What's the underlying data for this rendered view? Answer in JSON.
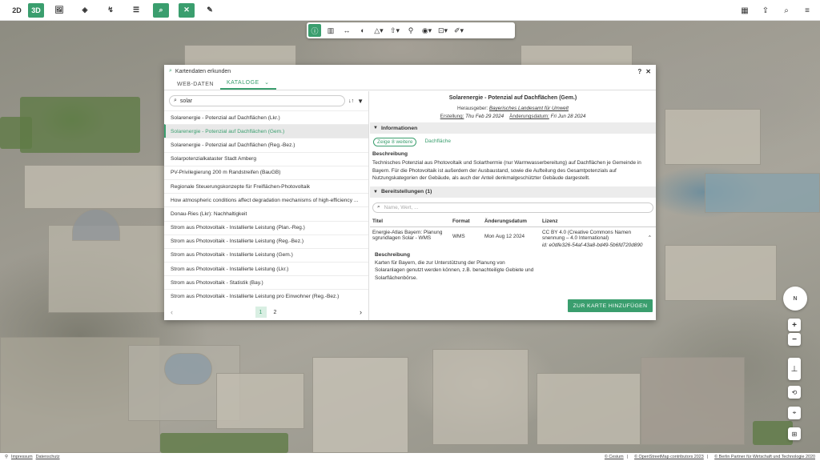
{
  "topbar": {
    "btn_2d": "2D",
    "btn_3d": "3D",
    "icons": [
      "image-icon",
      "layers-icon",
      "route-icon",
      "filter-list-icon",
      "map-search-icon",
      "tools-icon",
      "bookmark-icon"
    ],
    "right_icons": [
      "grid-icon",
      "share-icon",
      "search-icon",
      "menu-icon"
    ]
  },
  "center_toolbar": {
    "icons": [
      "info-icon",
      "split-view-icon",
      "measure-icon",
      "shadow-icon",
      "draw-icon",
      "upload-icon",
      "walk-icon",
      "visibility-icon",
      "clip-icon",
      "edit-icon"
    ]
  },
  "window": {
    "title": "Kartendaten erkunden",
    "help": "?",
    "close": "✕",
    "tabs": [
      "WEB-DATEN",
      "KATALOGE"
    ],
    "tab_chevron": "⌄",
    "search_value": "solar",
    "results": [
      "Solarenergie - Potenzial auf Dachflächen (Lkr.)",
      "Solarenergie - Potenzial auf Dachflächen (Gem.)",
      "Solarenergie - Potenzial auf Dachflächen (Reg.-Bez.)",
      "Solarpotenzialkataster Stadt Amberg",
      "PV-Privilegierung 200 m Randstreifen (BauGB)",
      "Regionale Steuerungskonzepte für Freiflächen-Photovoltaik",
      "How atmospheric conditions affect degradation mechanisms of high-efficiency ...",
      "Donau-Ries (Lkr): Nachhaltigkeit",
      "Strom aus Photovoltaik - Installierte Leistung (Plan.-Reg.)",
      "Strom aus Photovoltaik - Installierte Leistung (Reg.-Bez.)",
      "Strom aus Photovoltaik - Installierte Leistung (Gem.)",
      "Strom aus Photovoltaik - Installierte Leistung (Lkr.)",
      "Strom aus Photovoltaik - Statistik (Bay.)",
      "Strom aus Photovoltaik - Installierte Leistung pro Einwohner (Reg.-Bez.)"
    ],
    "pager": {
      "prev": "‹",
      "pages": [
        "1",
        "2"
      ],
      "next": "›"
    },
    "detail": {
      "title": "Solarenergie - Potenzial auf Dachflächen (Gem.)",
      "publisher_label": "Herausgeber:",
      "publisher": "Bayerisches Landesamt für Umwelt",
      "created_label": "Erstellung:",
      "created": "Thu Feb 29 2024",
      "modified_label": "Änderungsdatum:",
      "modified": "Fri Jun 28 2024",
      "info_section": "Informationen",
      "chip_more": "Zeige 8 weitere",
      "chip_tag": "Dachfläche",
      "desc_label": "Beschreibung",
      "desc_text": "Technisches Potenzial aus Photovoltaik und Solarthermie (nur Warmwasserbereitung) auf Dachflächen je Gemeinde in Bayern. Für die Photovoltaik ist außerdem der Ausbaustand, sowie die Aufteilung des Gesamtpotenzials auf Nutzungskategorien der Gebäude, als auch der Anteil denkmalgeschützter Gebäude dargestellt.",
      "dist_section": "Bereitstellungen (1)",
      "dist_search_placeholder": "Name, Wert, ...",
      "table_headers": [
        "Titel",
        "Format",
        "Änderungsdatum",
        "Lizenz"
      ],
      "row": {
        "title": "Energie-Atlas Bayern: Planung sgrundlagen Solar - WMS",
        "format": "WMS",
        "date": "Mon Aug 12 2024",
        "license": "CC BY 4.0 (Creative Commons Namen snennung – 4.0 International)",
        "id": "id: e0dfe326-54af-43a8-bd49-5b6fd720d890"
      },
      "dist_desc_label": "Beschreibung",
      "dist_desc_text": "Karten für Bayern, die zur Unterstützung der Planung von Solaranlagen genutzt werden können, z.B. benachteiligte Gebiete und Solarflächenbörse.",
      "add_button": "ZUR KARTE HINZUFÜGEN"
    }
  },
  "controls": {
    "compass": "N",
    "zoom_in": "+",
    "zoom_out": "−"
  },
  "footer": {
    "impressum": "Impressum",
    "datenschutz": "Datenschutz",
    "credits": [
      "© Cesium",
      "© OpenStreetMap contributors 2023",
      "© Berlin Partner für Wirtschaft und Technologie 2020"
    ]
  },
  "colors": {
    "accent": "#3a9e6e"
  }
}
